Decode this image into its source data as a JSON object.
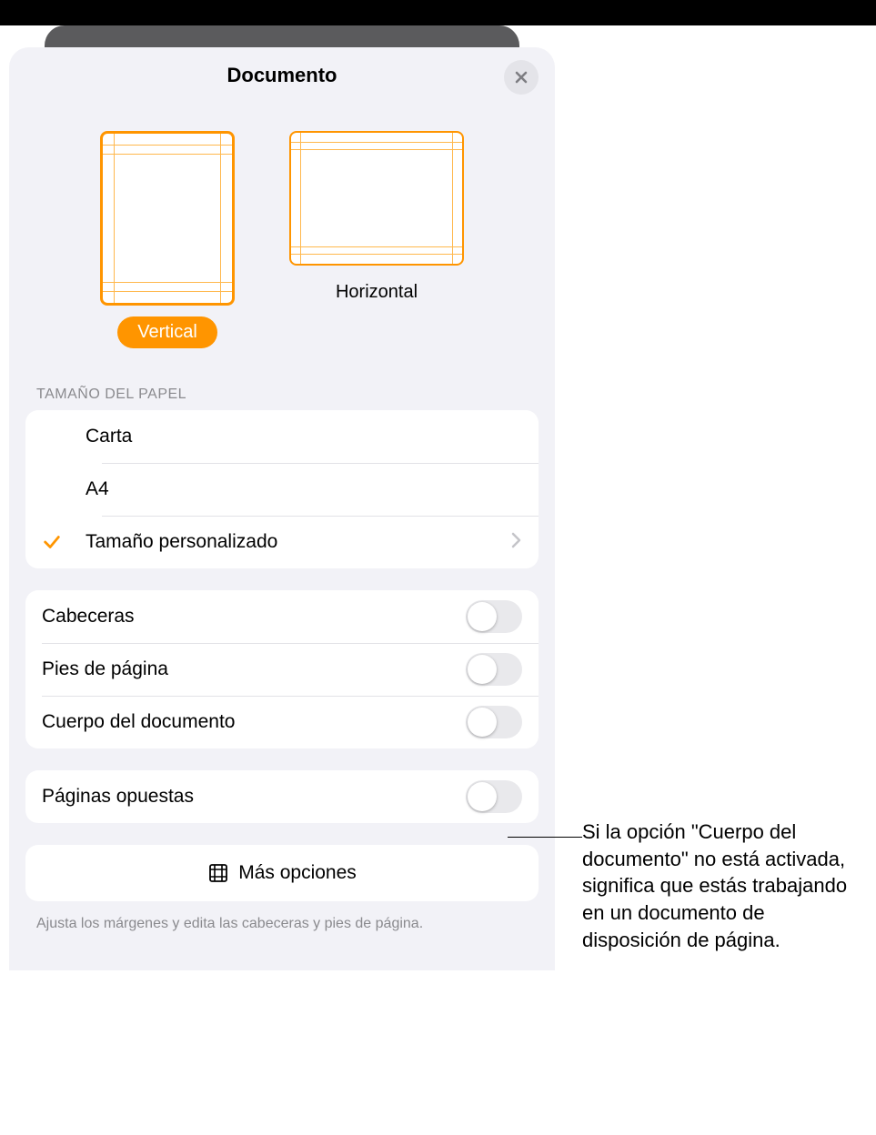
{
  "panel": {
    "title": "Documento"
  },
  "orientation": {
    "vertical_label": "Vertical",
    "horizontal_label": "Horizontal",
    "selected": "vertical"
  },
  "paper": {
    "section_label": "TAMAÑO DEL PAPEL",
    "options": [
      {
        "label": "Carta",
        "selected": false,
        "disclosure": false
      },
      {
        "label": "A4",
        "selected": false,
        "disclosure": false
      },
      {
        "label": "Tamaño personalizado",
        "selected": true,
        "disclosure": true
      }
    ]
  },
  "toggles": {
    "headers_label": "Cabeceras",
    "footers_label": "Pies de página",
    "body_label": "Cuerpo del documento",
    "facing_label": "Páginas opuestas"
  },
  "more_options_label": "Más opciones",
  "footer_hint": "Ajusta los márgenes y edita las cabeceras y pies de página.",
  "callout_text": "Si la opción \"Cuerpo del documento\" no está activada, significa que estás trabajando en un documento de disposición de página.",
  "colors": {
    "accent": "#ff9500"
  }
}
